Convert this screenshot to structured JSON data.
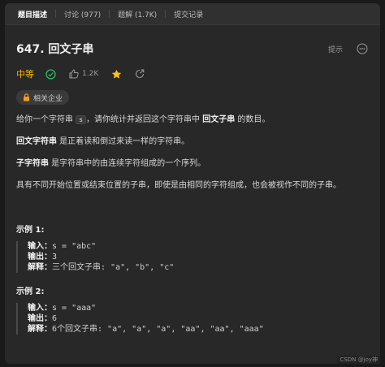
{
  "tabs": [
    {
      "label": "题目描述",
      "active": true
    },
    {
      "label": "讨论 (977)",
      "active": false
    },
    {
      "label": "题解 (1.7K)",
      "active": false
    },
    {
      "label": "提交记录",
      "active": false
    }
  ],
  "problem": {
    "title": "647. 回文子串",
    "hint_label": "提示",
    "difficulty": "中等",
    "likes": "1.2K",
    "company_tag": "相关企业"
  },
  "description": {
    "p1": [
      "给你一个字符串 ",
      "s",
      "，请你统计并返回这个字符串中 ",
      "回文子串",
      " 的数目。"
    ],
    "p2": [
      "回文字符串",
      " 是正着读和倒过来读一样的字符串。"
    ],
    "p3": [
      "子字符串",
      " 是字符串中的由连续字符组成的一个序列。"
    ],
    "p4": "具有不同开始位置或结束位置的子串，即使是由相同的字符组成，也会被视作不同的子串。"
  },
  "examples": [
    {
      "title": "示例 1:",
      "input_label": "输入：",
      "input": "s = \"abc\"",
      "output_label": "输出：",
      "output": "3",
      "explain_label": "解释：",
      "explain": "三个回文子串: \"a\", \"b\", \"c\""
    },
    {
      "title": "示例 2:",
      "input_label": "输入：",
      "input": "s = \"aaa\"",
      "output_label": "输出：",
      "output": "6",
      "explain_label": "解释：",
      "explain": "6个回文子串: \"a\", \"a\", \"a\", \"aa\", \"aa\", \"aaa\""
    }
  ],
  "watermark": "CSDN @joy神",
  "colors": {
    "difficulty": "#ffb800",
    "accepted": "#2cbb5d",
    "star": "#ffc01e"
  },
  "icons": {
    "accepted": "check-circle-icon",
    "like": "thumbs-up-icon",
    "favorite": "star-icon",
    "share": "share-icon",
    "more": "more-icon",
    "lock": "lock-icon"
  }
}
